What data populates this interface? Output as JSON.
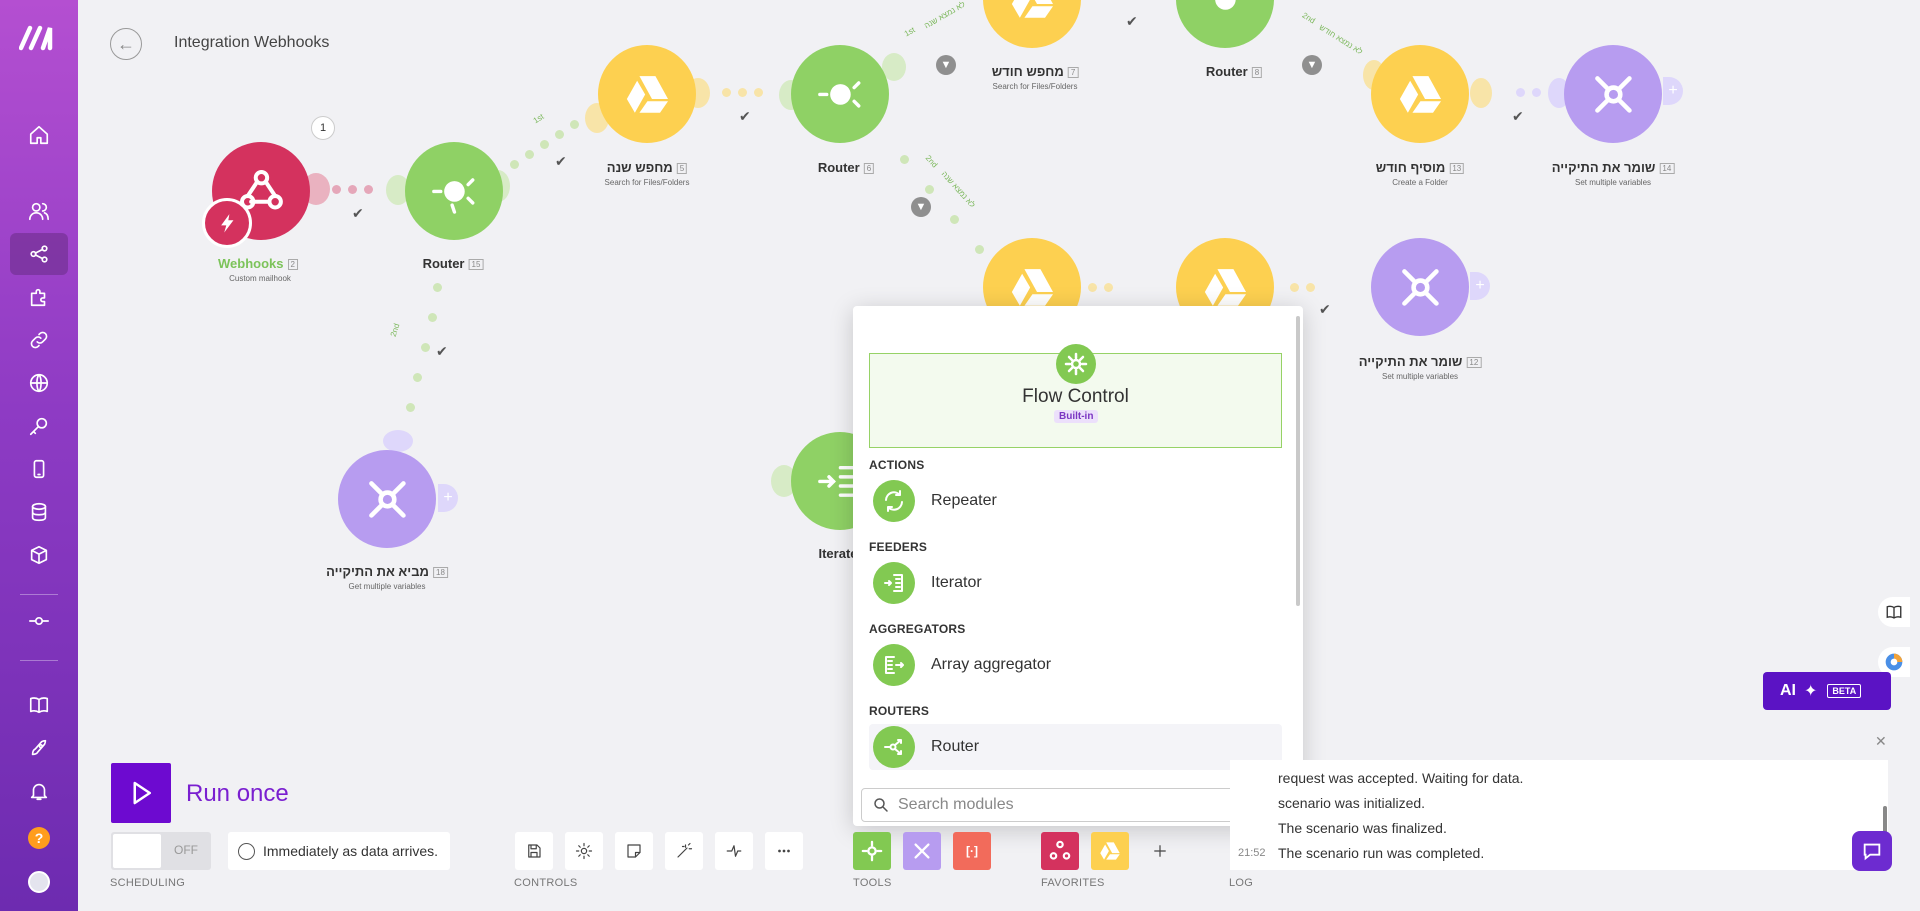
{
  "header": {
    "title": "Integration Webhooks"
  },
  "canvas": {
    "count_bubble": "1",
    "nodes": {
      "webhooks": {
        "label": "Webhooks",
        "num": "2",
        "sub": "Custom mailhook"
      },
      "router15": {
        "label": "Router",
        "num": "15"
      },
      "search_year": {
        "label": "מחפש שנה",
        "num": "5",
        "sub": "Search for Files/Folders"
      },
      "router6": {
        "label": "Router",
        "num": "6"
      },
      "search_month": {
        "label": "מחפש חודש",
        "num": "7",
        "sub": "Search for Files/Folders"
      },
      "router8": {
        "label": "Router",
        "num": "8"
      },
      "add_month": {
        "label": "מוסיף חודש",
        "num": "13",
        "sub": "Create a Folder"
      },
      "save_folder14": {
        "label": "שומר את התיקייה",
        "num": "14",
        "sub": "Set multiple variables"
      },
      "save_folder12": {
        "label": "שומר את התיקייה",
        "num": "12",
        "sub": "Set multiple variables"
      },
      "get_folder18": {
        "label": "מביא את התיקייה",
        "num": "18",
        "sub": "Get multiple variables"
      },
      "iterator": {
        "label": "Iterate"
      }
    },
    "routes": {
      "r1": "1st",
      "r2": "2nd",
      "r3": "1st",
      "r3b": "לא נמצא שנה",
      "r4": "2nd",
      "r4b": "לא נמצא שנה",
      "r5": "2nd",
      "r5b": "לא נמצא חודש"
    }
  },
  "picker": {
    "app_name": "Flow Control",
    "app_badge": "Built-in",
    "sections": [
      {
        "title": "ACTIONS",
        "item": "Repeater"
      },
      {
        "title": "FEEDERS",
        "item": "Iterator"
      },
      {
        "title": "AGGREGATORS",
        "item": "Array aggregator"
      },
      {
        "title": "ROUTERS",
        "item": "Router"
      }
    ],
    "search_placeholder": "Search modules"
  },
  "toolbar": {
    "run_label": "Run once",
    "toggle_state": "OFF",
    "schedule_text": "Immediately as data arrives.",
    "sections": {
      "scheduling": "SCHEDULING",
      "controls": "CONTROLS",
      "tools": "TOOLS",
      "favorites": "FAVORITES",
      "log": "LOG"
    },
    "tool_bracket": "[·]"
  },
  "log": {
    "lines": [
      {
        "time": "",
        "text": "request was accepted. Waiting for data."
      },
      {
        "time": "",
        "text": "scenario was initialized."
      },
      {
        "time": "",
        "text": "The scenario was finalized."
      },
      {
        "time": "21:52",
        "text": "The scenario run was completed."
      }
    ]
  },
  "ai": {
    "label": "AI",
    "beta": "BETA"
  },
  "colors": {
    "drive": "#fdd050",
    "router": "#8fd165",
    "webhook": "#d4325e",
    "tools": "#b79cf0",
    "brand": "#6d0ad0"
  }
}
